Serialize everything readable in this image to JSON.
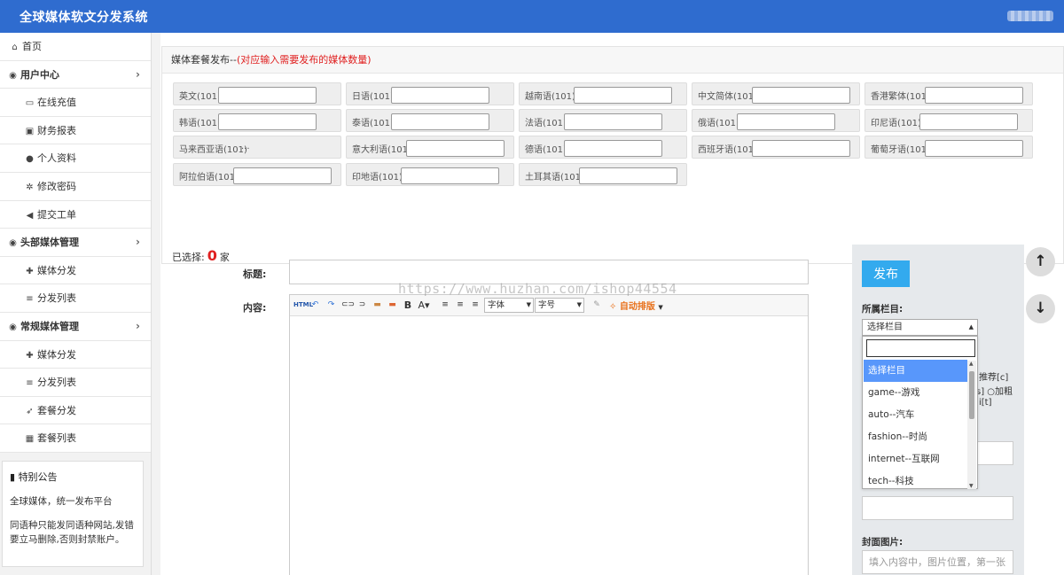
{
  "header": {
    "title": "全球媒体软文分发系统"
  },
  "sidebar": {
    "items": [
      {
        "label": "首页",
        "icon": "home-icon",
        "glyph": "⌂",
        "kind": "top"
      },
      {
        "label": "用户中心",
        "icon": "globe-icon",
        "glyph": "◉",
        "kind": "section"
      },
      {
        "label": "在线充值",
        "icon": "card-icon",
        "glyph": "▭",
        "kind": "sub"
      },
      {
        "label": "财务报表",
        "icon": "money-icon",
        "glyph": "▣",
        "kind": "sub"
      },
      {
        "label": "个人资料",
        "icon": "user-icon",
        "glyph": "●",
        "kind": "sub"
      },
      {
        "label": "修改密码",
        "icon": "gear-icon",
        "glyph": "✲",
        "kind": "sub"
      },
      {
        "label": "提交工单",
        "icon": "volume-icon",
        "glyph": "◀",
        "kind": "sub"
      },
      {
        "label": "头部媒体管理",
        "icon": "globe-icon",
        "glyph": "◉",
        "kind": "section"
      },
      {
        "label": "媒体分发",
        "icon": "plus-icon",
        "glyph": "✚",
        "kind": "sub"
      },
      {
        "label": "分发列表",
        "icon": "list-icon",
        "glyph": "≡",
        "kind": "sub"
      },
      {
        "label": "常规媒体管理",
        "icon": "globe-icon",
        "glyph": "◉",
        "kind": "section"
      },
      {
        "label": "媒体分发",
        "icon": "plus-icon",
        "glyph": "✚",
        "kind": "sub"
      },
      {
        "label": "分发列表",
        "icon": "list-icon",
        "glyph": "≡",
        "kind": "sub"
      },
      {
        "label": "套餐分发",
        "icon": "send-icon",
        "glyph": "➶",
        "kind": "sub"
      },
      {
        "label": "套餐列表",
        "icon": "grid-icon",
        "glyph": "▦",
        "kind": "sub"
      }
    ],
    "notice": {
      "title": "特别公告",
      "lines": [
        "全球媒体，统一发布平台",
        "同语种只能发同语种网站,发错",
        "要立马删除,否则封禁账户。"
      ]
    }
  },
  "package": {
    "heading": "媒体套餐发布--",
    "heading_note": "(对应输入需要发布的媒体数量)",
    "languages": [
      {
        "label": "英文(101)"
      },
      {
        "label": "日语(101)"
      },
      {
        "label": "越南语(101)"
      },
      {
        "label": "中文简体(101)"
      },
      {
        "label": "香港繁体(101)"
      },
      {
        "label": "韩语(101)"
      },
      {
        "label": "泰语(101)"
      },
      {
        "label": "法语(101)"
      },
      {
        "label": "俄语(101)"
      },
      {
        "label": "印尼语(101)"
      },
      {
        "label": "马来西亚语(101)",
        "value": "..."
      },
      {
        "label": "意大利语(101)"
      },
      {
        "label": "德语(101)"
      },
      {
        "label": "西班牙语(101)"
      },
      {
        "label": "葡萄牙语(101)"
      },
      {
        "label": "阿拉伯语(101)"
      },
      {
        "label": "印地语(101)"
      },
      {
        "label": "土耳其语(101)"
      }
    ],
    "selected_label": "已选择:",
    "selected_count": "0",
    "selected_unit": "家"
  },
  "form": {
    "title_label": "标题:",
    "content_label": "内容:",
    "font_select": "字体",
    "size_select": "字号",
    "auto_format": "自动排版",
    "watermark": "https://www.huzhan.com/ishop44554"
  },
  "right_panel": {
    "publish_label": "发布",
    "category_label": "所属栏目:",
    "category_value": "选择栏目",
    "partial_lines": [
      "推荐[c]",
      "s] ○加粗",
      "i[t]"
    ],
    "cover_label": "封面图片:",
    "cover_placeholder": "填入内容中，图片位置，第一张"
  },
  "dropdown": {
    "options": [
      "选择栏目",
      "game--游戏",
      "auto--汽车",
      "fashion--时尚",
      "internet--互联网",
      "tech--科技"
    ]
  }
}
